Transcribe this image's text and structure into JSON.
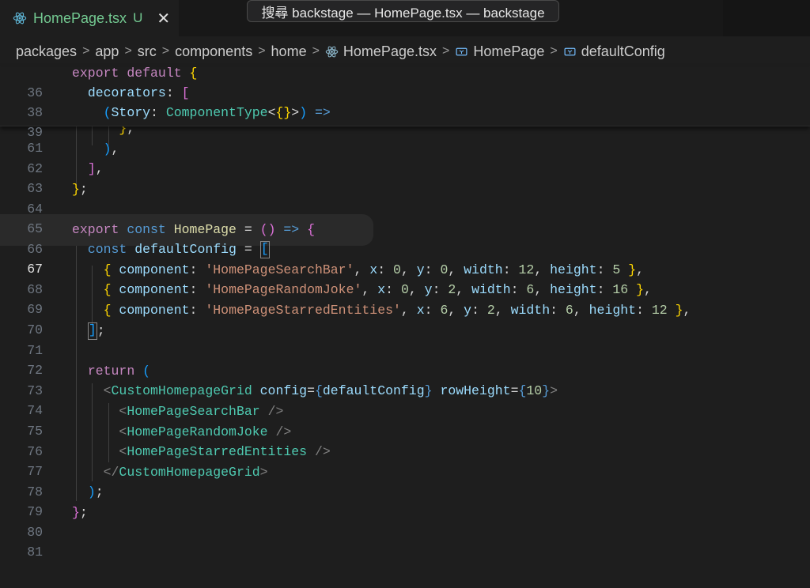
{
  "tab": {
    "filename": "HomePage.tsx",
    "status": "U",
    "close_glyph": "✕",
    "icon": "react-icon"
  },
  "command_center": {
    "text": "搜尋 backstage — HomePage.tsx — backstage"
  },
  "breadcrumb": {
    "items": [
      "packages",
      "app",
      "src",
      "components",
      "home",
      "HomePage.tsx",
      "HomePage",
      "defaultConfig"
    ],
    "separator": ">",
    "icons": [
      "react-icon",
      "symbol-variable-icon",
      "symbol-variable-icon"
    ]
  },
  "editor": {
    "active_line": "67",
    "lines": [
      {
        "n": "36",
        "text": "export default {"
      },
      {
        "n": "38",
        "text": "  decorators: ["
      },
      {
        "n": "39",
        "text": "    (Story: ComponentType<{}>) =>"
      },
      {
        "n": "61",
        "text": "      },"
      },
      {
        "n": "62",
        "text": "    ),"
      },
      {
        "n": "63",
        "text": "  ],"
      },
      {
        "n": "64",
        "text": "};"
      },
      {
        "n": "65",
        "text": ""
      },
      {
        "n": "66",
        "text": "export const HomePage = () => {"
      },
      {
        "n": "67",
        "text": "  const defaultConfig = ["
      },
      {
        "n": "68",
        "text": "    { component: 'HomePageSearchBar', x: 0, y: 0, width: 12, height: 5 },"
      },
      {
        "n": "69",
        "text": "    { component: 'HomePageRandomJoke', x: 0, y: 2, width: 6, height: 16 },"
      },
      {
        "n": "70",
        "text": "    { component: 'HomePageStarredEntities', x: 6, y: 2, width: 6, height: 12 },"
      },
      {
        "n": "71",
        "text": "  ];"
      },
      {
        "n": "72",
        "text": ""
      },
      {
        "n": "73",
        "text": "  return ("
      },
      {
        "n": "74",
        "text": "    <CustomHomepageGrid config={defaultConfig} rowHeight={10}>"
      },
      {
        "n": "75",
        "text": "      <HomePageSearchBar />"
      },
      {
        "n": "76",
        "text": "      <HomePageRandomJoke />"
      },
      {
        "n": "77",
        "text": "      <HomePageStarredEntities />"
      },
      {
        "n": "78",
        "text": "    </CustomHomepageGrid>"
      },
      {
        "n": "79",
        "text": "  );"
      },
      {
        "n": "80",
        "text": "};"
      },
      {
        "n": "81",
        "text": ""
      }
    ]
  },
  "colors": {
    "background": "#1e1e1e",
    "tab_modified_green": "#73c991",
    "keyword": "#c586c0",
    "string": "#ce9178",
    "type": "#4ec9b0"
  }
}
